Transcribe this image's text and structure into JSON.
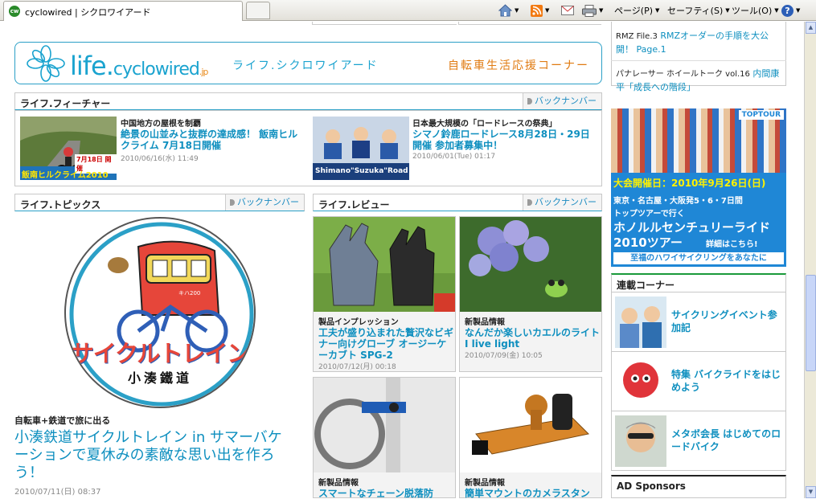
{
  "browser": {
    "tab_title": "cyclowired | シクロワイアード",
    "favicon": "cw",
    "toolbar": {
      "page": "ページ(P)",
      "safety": "セーフティ(S)",
      "tools": "ツール(O)",
      "help": "?"
    }
  },
  "banner": {
    "logo_main": "life.",
    "logo_brand": "cyclowired",
    "logo_tld": ".jp",
    "subtitle": "ライフ.シクロワイアード",
    "tagline": "自転車生活応援コーナー"
  },
  "feature": {
    "title": "ライフ.フィーチャー",
    "back": "バックナンバー",
    "items": [
      {
        "category": "中国地方の屋根を制覇",
        "headline": "絶景の山並みと抜群の達成感！ 飯南ヒルクライム 7月18日開催",
        "date": "2010/06/16(水) 11:49",
        "thumb_text": "飯南ヒルクライム2010",
        "thumb_date": "7月18日 開催"
      },
      {
        "category": "日本最大規模の「ロードレースの祭典」",
        "headline": "シマノ鈴鹿ロードレース8月28日・29日開催 参加者募集中！",
        "date": "2010/06/01(Tue) 01:17",
        "thumb_text": "Shimano\"Suzuka\"Road"
      }
    ]
  },
  "topics": {
    "title": "ライフ.トピックス",
    "back": "バックナンバー",
    "logo_text": "サイクルトレイン",
    "logo_sub": "小湊鐵道",
    "train_number": "キハ200",
    "category": "自転車+鉄道で旅に出る",
    "headline": "小湊鉄道サイクルトレイン in サマーバケーションで夏休みの素敵な思い出を作ろう！",
    "date": "2010/07/11(日) 08:37"
  },
  "review": {
    "title": "ライフ.レビュー",
    "back": "バックナンバー",
    "items": [
      {
        "category": "製品インプレッション",
        "headline": "工夫が盛り込まれた贅沢なビギナー向けグローブ オージーケーカブト SPG-2",
        "date": "2010/07/12(月) 00:18"
      },
      {
        "category": "新製品情報",
        "headline": "なんだか楽しいカエルのライト I live light",
        "date": "2010/07/09(金) 10:05"
      },
      {
        "category": "新製品情報",
        "headline": "スマートなチェーン脱落防",
        "date": ""
      },
      {
        "category": "新製品情報",
        "headline": "簡単マウントのカメラスタン",
        "date": ""
      }
    ]
  },
  "right": {
    "links": [
      {
        "prefix": "RMZ File.3",
        "text": "RMZオーダーの手順を大公開！ Page.1"
      },
      {
        "prefix": "パナレーサー ホイールトーク vol.16",
        "text": "内間康平「成長への階段」"
      }
    ],
    "ad": {
      "brand": "TOPTOUR",
      "date_line": "大会開催日：2010年9月26日(日)",
      "cities": "東京・名古屋・大阪発5・6・7日間",
      "lead": "トップツアーで行く",
      "main": "ホノルルセンチュリーライド",
      "year": "2010ツアー",
      "detail": "詳細はこちら!",
      "footer": "至福のハワイサイクリングをあなたに"
    },
    "serial": {
      "title": "連載コーナー",
      "items": [
        {
          "text": "サイクリングイベント参加記"
        },
        {
          "text": "特集 バイクライドをはじめよう"
        },
        {
          "text": "メタボ会長 はじめてのロードバイク"
        }
      ]
    },
    "sponsors_title": "AD Sponsors"
  },
  "colors": {
    "accent": "#1aa3cf",
    "orange": "#e07b12",
    "ad_blue": "#1f87d6"
  }
}
